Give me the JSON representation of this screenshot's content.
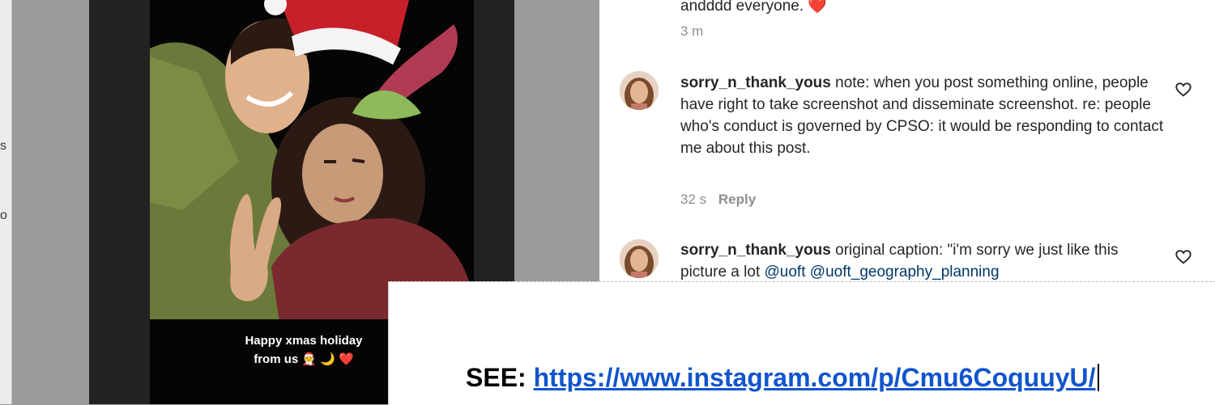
{
  "left_strip": {
    "fragment_1": "s",
    "fragment_2": "o"
  },
  "post": {
    "caption_line1": "Happy xmas holiday",
    "caption_line2": "from us",
    "caption_emojis": "🧑‍🎄 🌙 ❤️"
  },
  "comments": [
    {
      "text_tail": "andddd everyone.",
      "emoji": "❤️",
      "time": "3 m"
    },
    {
      "username": "sorry_n_thank_yous",
      "text": "note: when you post something online, people have right to take screenshot and disseminate screenshot. re: people who's conduct is governed by CPSO: it would be responding to contact me about this post.",
      "time": "32 s",
      "reply_label": "Reply"
    },
    {
      "username": "sorry_n_thank_yous",
      "text": "original caption: \"i'm sorry we just like this picture a lot",
      "mention_1": "@uoft",
      "mention_2": "@uoft_geography_planning"
    }
  ],
  "overlay": {
    "label": "SEE:",
    "link": "https://www.instagram.com/p/Cmu6CoquuyU/"
  },
  "colors": {
    "link": "#1155cc",
    "mention": "#00376b",
    "heart": "#e0245e"
  }
}
